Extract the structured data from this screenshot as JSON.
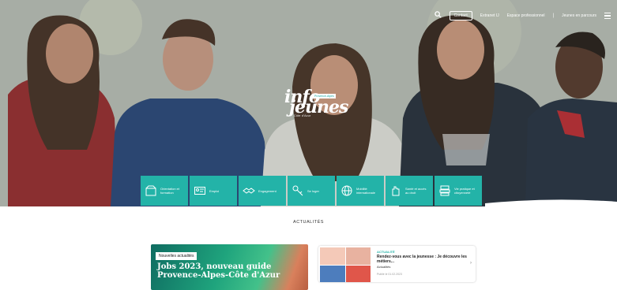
{
  "topbar": {
    "pill_label": "Contact",
    "link_1": "Extranet IJ",
    "link_2": "Espace professionnel",
    "link_3": "Jeunes en parcours"
  },
  "logo": {
    "line1": "info",
    "line2": "jeunes",
    "tag": "Provence-Alpes",
    "sub": "Côte d'Azur"
  },
  "tiles": [
    {
      "label": "Orientation et formation",
      "icon": "box-icon"
    },
    {
      "label": "Emploi",
      "icon": "id-card-icon"
    },
    {
      "label": "Engagement",
      "icon": "handshake-icon"
    },
    {
      "label": "Se loger",
      "icon": "key-icon"
    },
    {
      "label": "Mobilité internationale",
      "icon": "globe-icon"
    },
    {
      "label": "Santé et accès au droit",
      "icon": "hand-icon"
    },
    {
      "label": "Vie pratique et citoyenneté",
      "icon": "stack-icon"
    }
  ],
  "section_title": "ACTUALITÉS",
  "featured": {
    "badge": "Nouvelles actualités",
    "headline": "Jobs 2023, nouveau guide Provence-Alpes-Côte d'Azur"
  },
  "news": {
    "category": "ACTUALITÉ",
    "title": "Rendez-vous avec la jeunesse : Je découvre les métiers...",
    "tag": "Actualités",
    "date": "Publié le 01.02.2023"
  },
  "colors": {
    "teal": "#23b3a8",
    "white": "#ffffff"
  }
}
